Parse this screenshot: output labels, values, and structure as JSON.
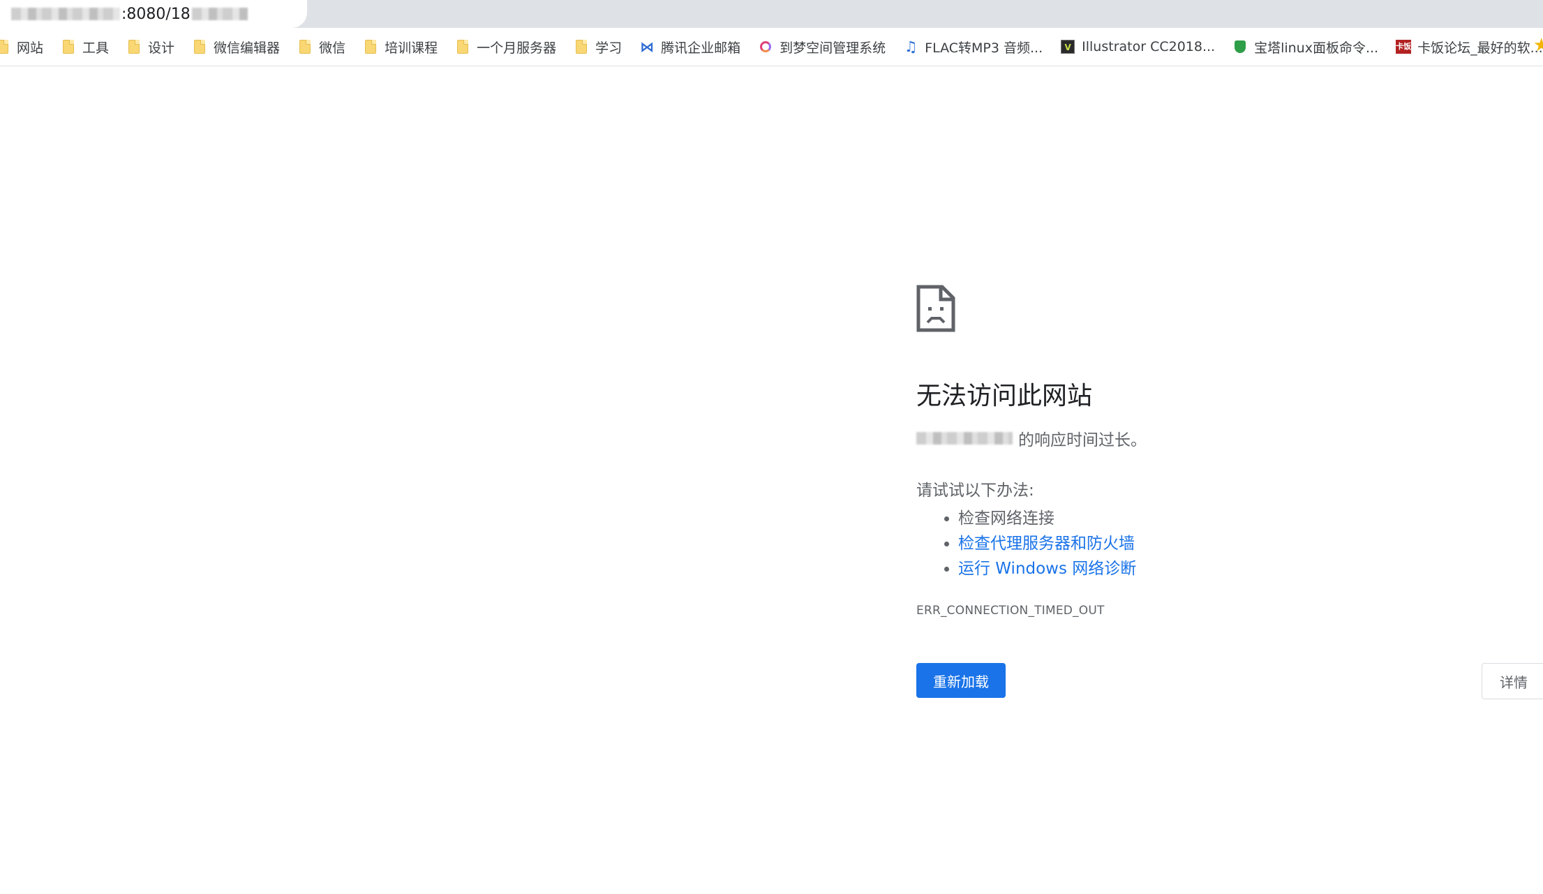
{
  "browser": {
    "url_visible": ":8080/18"
  },
  "bookmarks": [
    {
      "label": "网站",
      "icon": "folder-icon"
    },
    {
      "label": "工具",
      "icon": "folder-icon"
    },
    {
      "label": "设计",
      "icon": "folder-icon"
    },
    {
      "label": "微信编辑器",
      "icon": "folder-icon"
    },
    {
      "label": "微信",
      "icon": "folder-icon"
    },
    {
      "label": "培训课程",
      "icon": "folder-icon"
    },
    {
      "label": "一个月服务器",
      "icon": "folder-icon"
    },
    {
      "label": "学习",
      "icon": "folder-icon"
    },
    {
      "label": "腾讯企业邮箱",
      "icon": "tencent-mail-icon"
    },
    {
      "label": "到梦空间管理系统",
      "icon": "daomeng-icon"
    },
    {
      "label": "FLAC转MP3 音频...",
      "icon": "music-note-icon"
    },
    {
      "label": "Illustrator CC2018...",
      "icon": "illustrator-icon"
    },
    {
      "label": "宝塔linux面板命令...",
      "icon": "shield-icon"
    },
    {
      "label": "卡饭论坛_最好的软...",
      "icon": "kafan-icon"
    }
  ],
  "error_page": {
    "title": "无法访问此网站",
    "host_suffix": "的响应时间过长。",
    "suggestion_heading": "请试试以下办法:",
    "suggestions": [
      {
        "text": "检查网络连接",
        "link": false
      },
      {
        "text": "检查代理服务器和防火墙",
        "link": true
      },
      {
        "text": "运行 Windows 网络诊断",
        "link": true
      }
    ],
    "error_code": "ERR_CONNECTION_TIMED_OUT",
    "reload_label": "重新加载",
    "details_label": "详情"
  },
  "colors": {
    "accent": "#1a73e8",
    "folder": "#f9d774"
  }
}
